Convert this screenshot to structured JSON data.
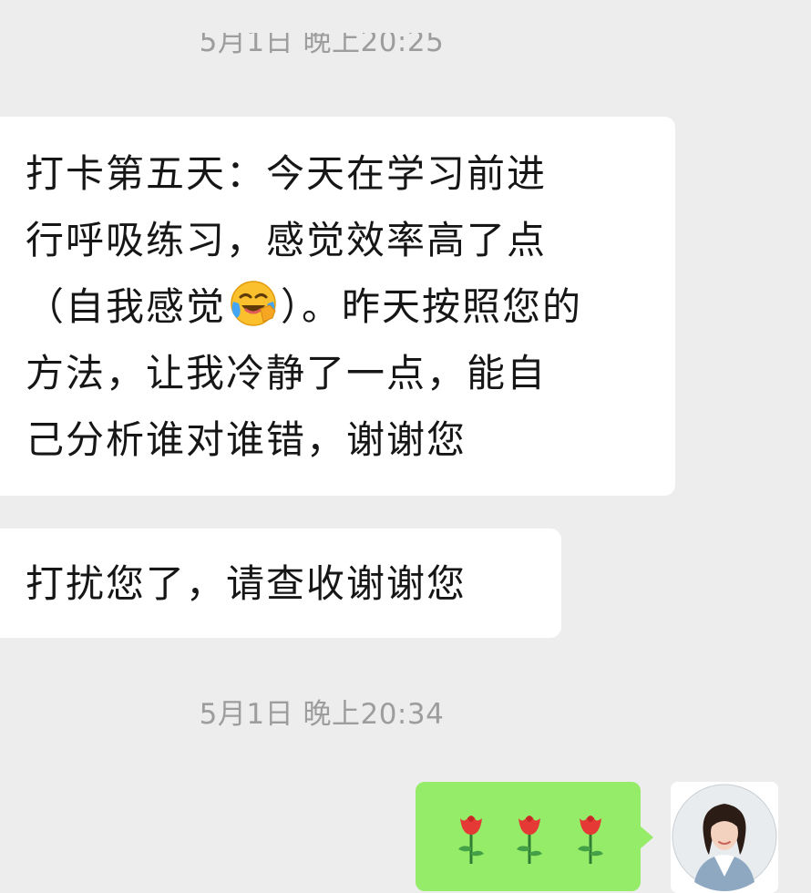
{
  "chat": {
    "timestamp_top": "5月1日 晚上20:25",
    "message_1_lines": [
      "打卡第五天：今天在学习前进",
      "行呼吸练习，感觉效率高了点",
      "（自我感觉",
      "）。昨天按照您的",
      "方法，让我冷静了一点，能自",
      "己分析谁对谁错，谢谢您"
    ],
    "message_1_emoji": "crying-laughing-face-emoji",
    "message_2": "打扰您了，请查收谢谢您",
    "timestamp_bottom": "5月1日 晚上20:34",
    "outgoing_emoji": [
      "rose-emoji",
      "rose-emoji",
      "rose-emoji"
    ],
    "colors": {
      "background": "#ededed",
      "incoming_bubble": "#ffffff",
      "outgoing_bubble": "#95ec69",
      "timestamp_text": "#9d9d9d"
    }
  }
}
